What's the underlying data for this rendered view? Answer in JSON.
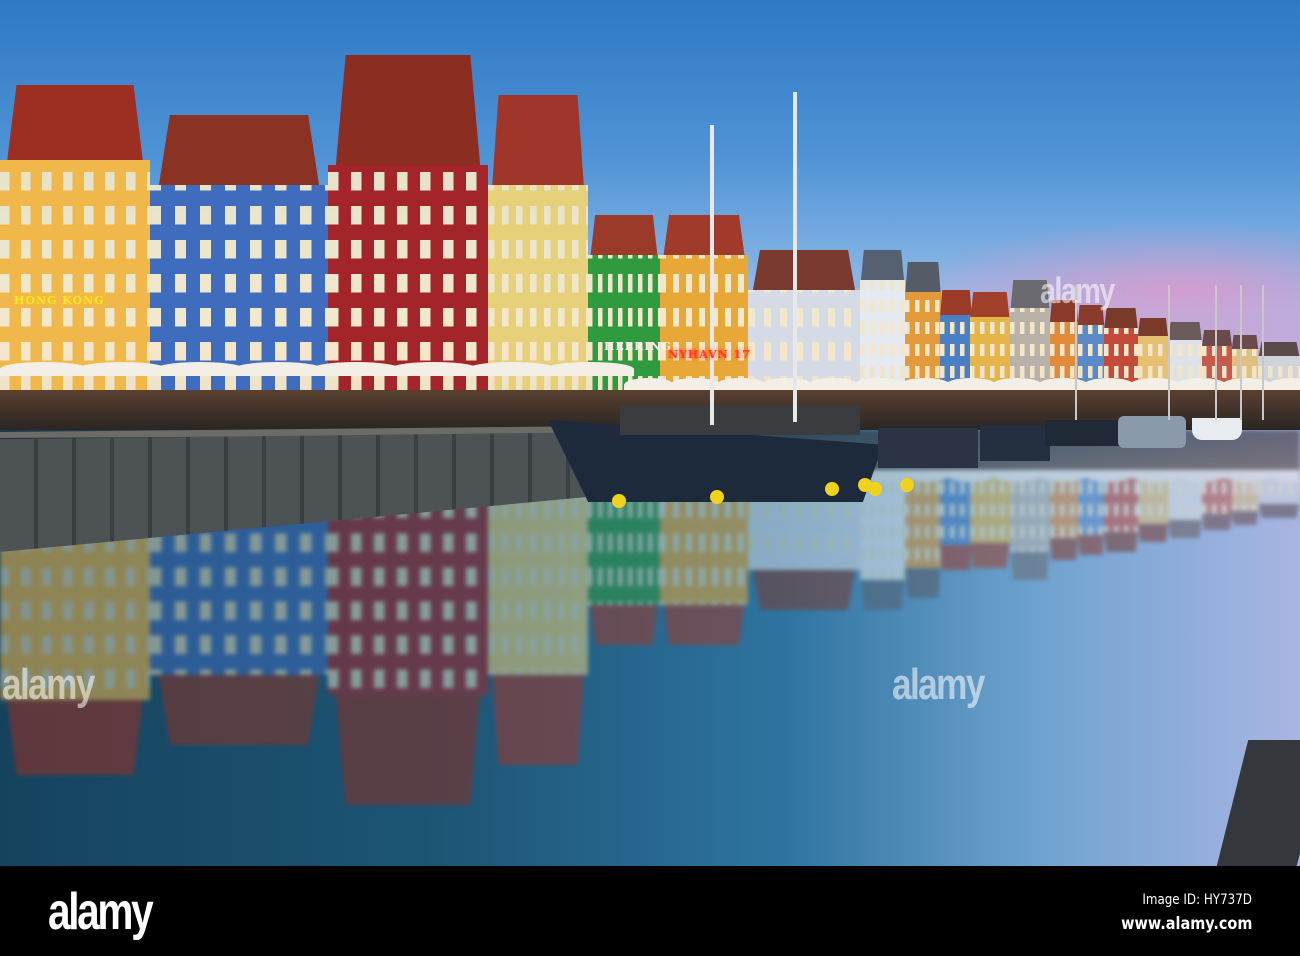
{
  "image": {
    "scene": "canal harbour at dusk",
    "signs": [
      "HONG KONG",
      "HEERING",
      "NYHAVN 17"
    ],
    "colors": {
      "sky": "#4f93d6",
      "water": "#2e73a0",
      "sunset": "#d89ad0"
    }
  },
  "watermark": {
    "overlay_text": "alamy",
    "logo": "alamy",
    "image_id": "Image ID: HY737D",
    "url": "www.alamy.com"
  }
}
